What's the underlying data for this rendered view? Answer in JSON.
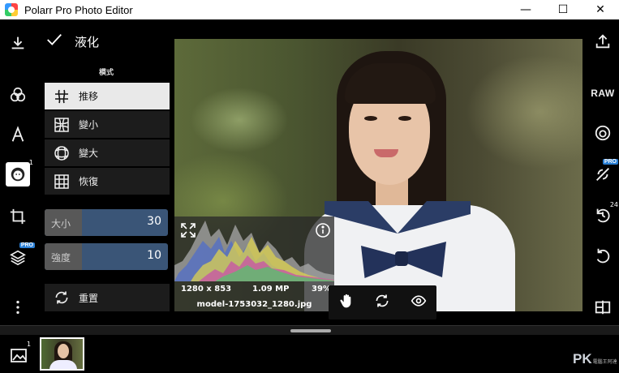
{
  "window": {
    "title": "Polarr Pro Photo Editor",
    "minimize_glyph": "—",
    "maximize_glyph": "☐",
    "close_glyph": "✕"
  },
  "left_toolbar": {
    "face_badge": "1",
    "pro_badge": "PRO"
  },
  "panel": {
    "title": "液化",
    "mode_label": "模式",
    "modes": [
      {
        "label": "推移",
        "icon": "grid-push-icon",
        "selected": true
      },
      {
        "label": "變小",
        "icon": "grid-shrink-icon",
        "selected": false
      },
      {
        "label": "變大",
        "icon": "grid-enlarge-icon",
        "selected": false
      },
      {
        "label": "恢復",
        "icon": "grid-restore-icon",
        "selected": false
      }
    ],
    "sliders": [
      {
        "label": "大小",
        "value": "30",
        "fraction": 0.3
      },
      {
        "label": "強度",
        "value": "10",
        "fraction": 0.3
      }
    ],
    "reset_label": "重置"
  },
  "histogram": {
    "resolution": "1280 x 853",
    "megapixels": "1.09 MP",
    "zoom": "39%",
    "filename": "model-1753032_1280.jpg"
  },
  "right_toolbar": {
    "raw_label": "RAW",
    "pro_badge": "PRO",
    "history_count": "24"
  },
  "filmstrip": {
    "gallery_badge": "1",
    "watermark_main": "PK",
    "watermark_sub": "電腦王阿達"
  },
  "colors": {
    "accent": "#3a5577",
    "pro_blue": "#2a7fd4",
    "selected_bg": "#e9e9e9"
  }
}
